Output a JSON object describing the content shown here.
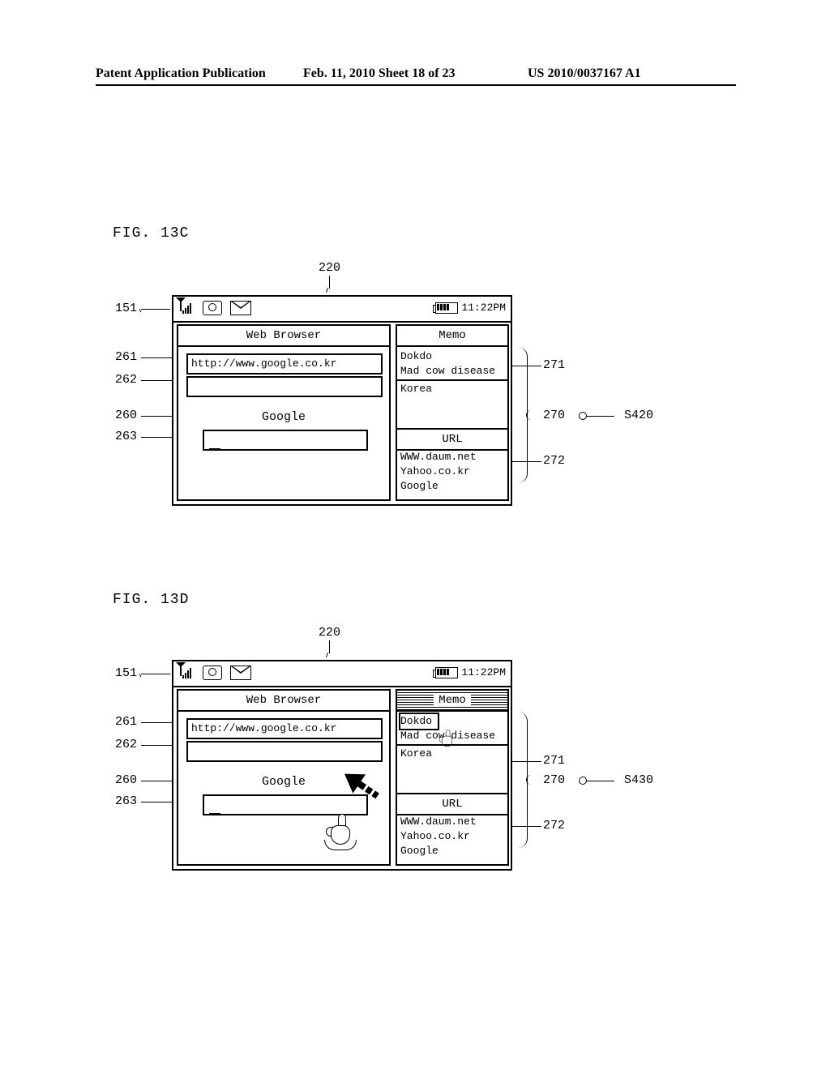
{
  "header": {
    "left": "Patent Application Publication",
    "middle": "Feb. 11, 2010  Sheet 18 of 23",
    "right": "US 2010/0037167 A1"
  },
  "figA": {
    "label": "FIG. 13C"
  },
  "figB": {
    "label": "FIG. 13D"
  },
  "callouts": {
    "c220": "220",
    "c151": "151",
    "c261": "261",
    "c262": "262",
    "c260": "260",
    "c263": "263",
    "c271": "271",
    "c270": "270",
    "c272": "272",
    "s420": "S420",
    "s430": "S430"
  },
  "status": {
    "time": "11:22PM"
  },
  "panels": {
    "browser_title": "Web Browser",
    "memo_title": "Memo",
    "url_value": "http://www.google.co.kr",
    "site_name": "Google",
    "memo_items": [
      "Dokdo",
      "Mad cow disease",
      "Korea"
    ],
    "url_section_label": "URL",
    "url_items": [
      "WWW.daum.net",
      "Yahoo.co.kr",
      "Google"
    ]
  }
}
